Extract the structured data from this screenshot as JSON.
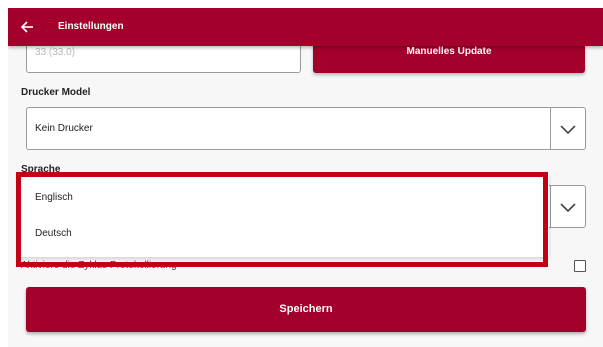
{
  "appbar": {
    "title": "Einstellungen",
    "color": "#a3002b"
  },
  "version": {
    "value": "33 (33.0)",
    "update_button_label": "Manuelles Update"
  },
  "printer": {
    "label": "Drucker Model",
    "selected": "Kein Drucker"
  },
  "language": {
    "label": "Sprache",
    "options": [
      "Englisch",
      "Deutsch"
    ]
  },
  "cycle_logging": {
    "label": "Aktiviere die Zyklus Protokollierung",
    "checked": false
  },
  "save_button_label": "Speichern",
  "highlight_color": "#c40014"
}
